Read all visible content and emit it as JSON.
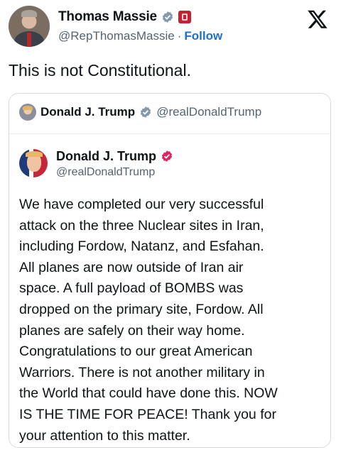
{
  "post": {
    "author": {
      "name": "Thomas Massie",
      "handle": "@RepThomasMassie",
      "separator": "·",
      "follow_label": "Follow"
    },
    "text": "This is not Constitutional.",
    "brand_icon": "x-logo-icon",
    "colors": {
      "follow": "#1d6fd6",
      "verified": "#829aab",
      "gov_badge": "#c62033",
      "pink_badge": "#e0245e"
    }
  },
  "quoted": {
    "author": {
      "name": "Donald J. Trump",
      "handle": "@realDonaldTrump"
    },
    "inner": {
      "name": "Donald J. Trump",
      "handle": "@realDonaldTrump",
      "lines": [
        "We have completed our very successful",
        "attack on the three Nuclear sites in Iran,",
        "including Fordow, Natanz, and Esfahan.",
        "All planes are now outside of Iran air",
        "space. A full payload of BOMBS was",
        "dropped on the primary site, Fordow. All",
        "planes are safely on their way home.",
        "Congratulations to our great American",
        "Warriors. There is not another military in",
        "the World that could have done this. NOW",
        "IS THE TIME FOR PEACE! Thank you for",
        "your attention to this matter."
      ]
    }
  }
}
